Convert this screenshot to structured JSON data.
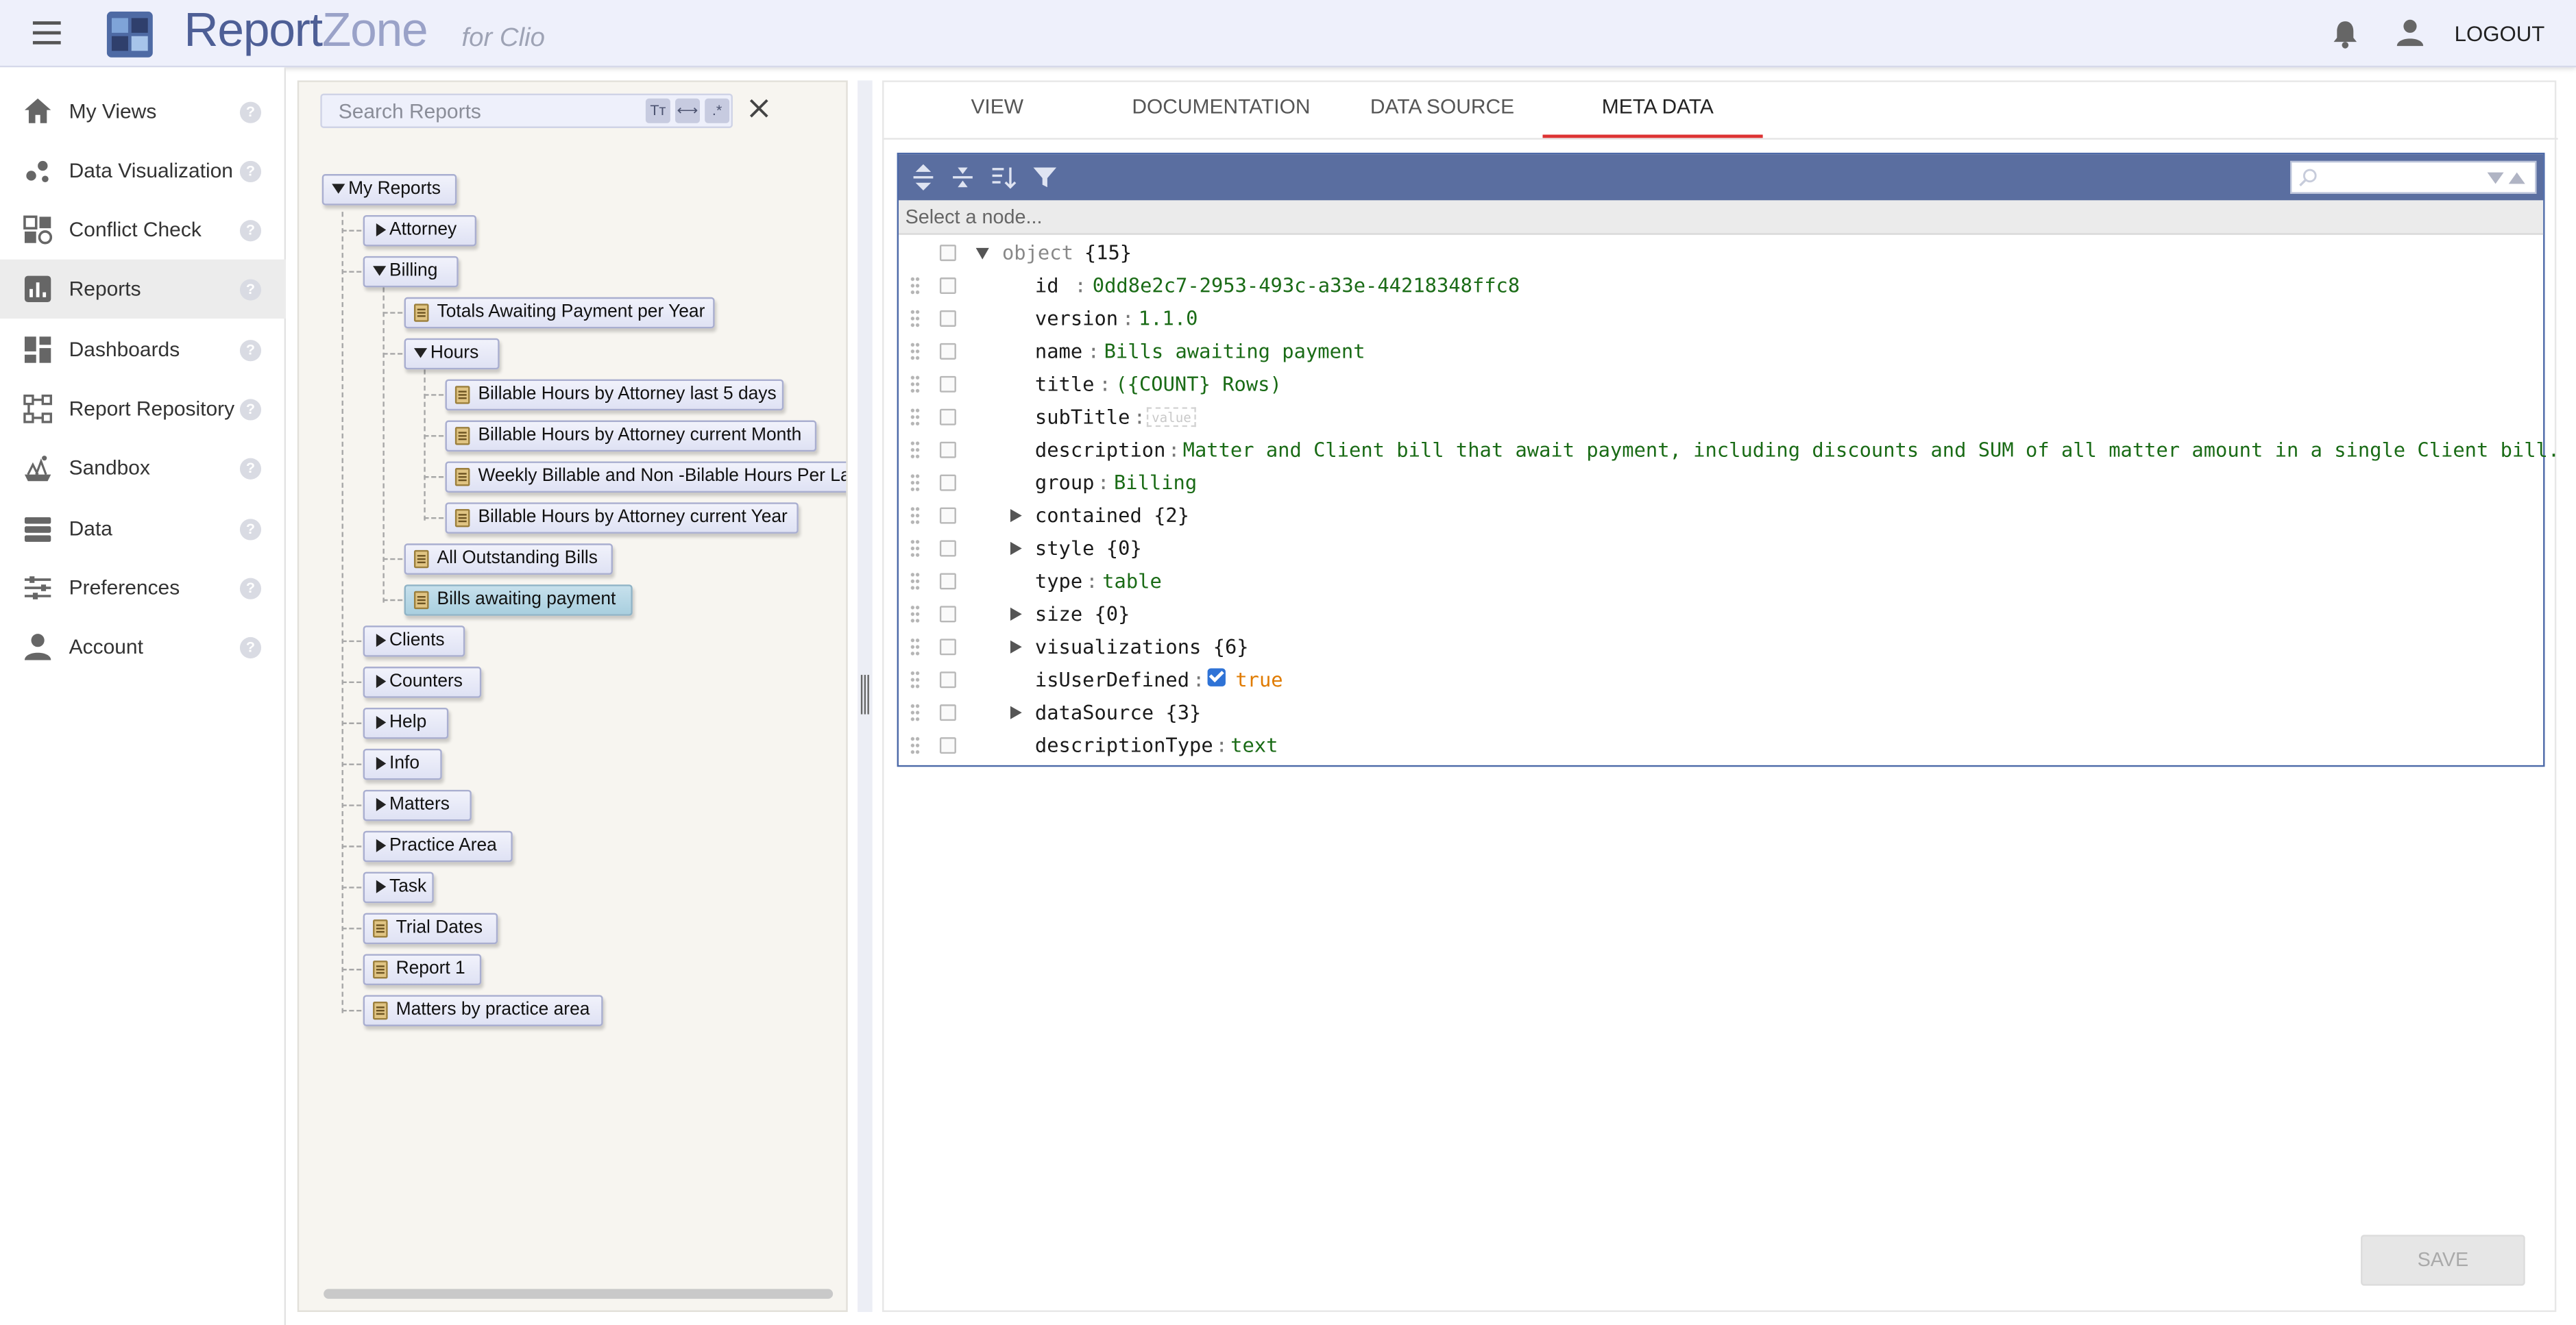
{
  "app": {
    "brand_part1": "Report",
    "brand_part2": "Zone",
    "brand_sub": "for Clio",
    "logout_label": "LOGOUT",
    "accent_color": "#5a6ea0",
    "active_tab_color": "#dd3333"
  },
  "sidebar": {
    "help_glyph": "?",
    "items": [
      {
        "label": "My Views",
        "icon": "home-icon"
      },
      {
        "label": "Data Visualization",
        "icon": "scatter-dots-icon"
      },
      {
        "label": "Conflict Check",
        "icon": "conflict-check-icon"
      },
      {
        "label": "Reports",
        "icon": "bar-chart-icon",
        "active": true
      },
      {
        "label": "Dashboards",
        "icon": "dashboard-icon"
      },
      {
        "label": "Report Repository",
        "icon": "hierarchy-icon"
      },
      {
        "label": "Sandbox",
        "icon": "sandbox-icon"
      },
      {
        "label": "Data",
        "icon": "database-icon"
      },
      {
        "label": "Preferences",
        "icon": "sliders-icon"
      },
      {
        "label": "Account",
        "icon": "person-icon"
      }
    ]
  },
  "tree": {
    "search_placeholder": "Search Reports",
    "search_options": [
      "Tт",
      "⟷",
      ".*"
    ],
    "nodes": {
      "my_reports": "My Reports",
      "attorney": "Attorney",
      "billing": "Billing",
      "totals_awaiting": "Totals Awaiting Payment per Year",
      "hours": "Hours",
      "bh_last5": "Billable Hours by Attorney last 5 days",
      "bh_month": "Billable Hours by Attorney current Month",
      "weekly": "Weekly Billable and Non -Bilable Hours Per La...",
      "bh_year": "Billable Hours by Attorney current Year",
      "all_outstanding": "All Outstanding Bills",
      "bills_awaiting": "Bills awaiting payment",
      "clients": "Clients",
      "counters": "Counters",
      "help": "Help",
      "info": "Info",
      "matters": "Matters",
      "practice_area": "Practice Area",
      "task": "Task",
      "trial_dates": "Trial Dates",
      "report1": "Report 1",
      "matters_by_pa": "Matters by practice area"
    }
  },
  "tabs": {
    "view": "VIEW",
    "documentation": "DOCUMENTATION",
    "data_source": "DATA SOURCE",
    "meta_data": "META DATA",
    "active": "META DATA"
  },
  "editor": {
    "path_placeholder": "Select a node...",
    "separator": ":",
    "rows": {
      "root_key": "object",
      "root_count": "{15}",
      "id_key": "id",
      "id_val": "0dd8e2c7-2953-493c-a33e-44218348ffc8",
      "version_key": "version",
      "version_val": "1.1.0",
      "name_key": "name",
      "name_val": "Bills awaiting payment",
      "title_key": "title",
      "title_val": "({COUNT} Rows)",
      "subtitle_key": "subTitle",
      "subtitle_placeholder": "value",
      "description_key": "description",
      "description_val": "Matter and Client bill that await payment, including discounts and SUM of all matter amount in a single Client bill.",
      "group_key": "group",
      "group_val": "Billing",
      "contained_key": "contained {2}",
      "style_key": "style {0}",
      "type_key": "type",
      "type_val": "table",
      "size_key": "size {0}",
      "visualizations_key": "visualizations {6}",
      "isuserdefined_key": "isUserDefined",
      "isuserdefined_val": "true",
      "datasource_key": "dataSource {3}",
      "descriptiontype_key": "descriptionType",
      "descriptiontype_val": "text"
    }
  },
  "footer": {
    "save_label": "SAVE"
  }
}
